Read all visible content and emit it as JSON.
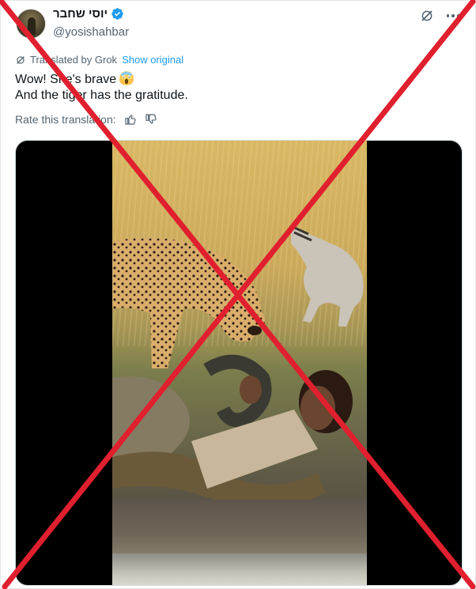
{
  "post": {
    "display_name": "יוסי שחבר",
    "handle": "@yosishahbar",
    "verified": true,
    "avatar_icon": "profile-avatar",
    "translation_bar": {
      "prefix": "Translated by Grok",
      "show_original": "Show original"
    },
    "text_lines": [
      "Wow! She's brave",
      "And the tiger has the gratitude."
    ],
    "emoji": "screaming-face-emoji",
    "rate": {
      "label": "Rate this translation:",
      "thumbs_up_icon": "thumbs-up-icon",
      "thumbs_down_icon": "thumbs-down-icon"
    },
    "media": {
      "type": "video",
      "scene": "cheetahs, python and a woman lying in mud"
    }
  },
  "overlay": {
    "type": "red-x",
    "color": "#e0202e"
  },
  "colors": {
    "accent": "#1d9bf0",
    "secondary_text": "#536471",
    "primary_text": "#0f1419"
  }
}
